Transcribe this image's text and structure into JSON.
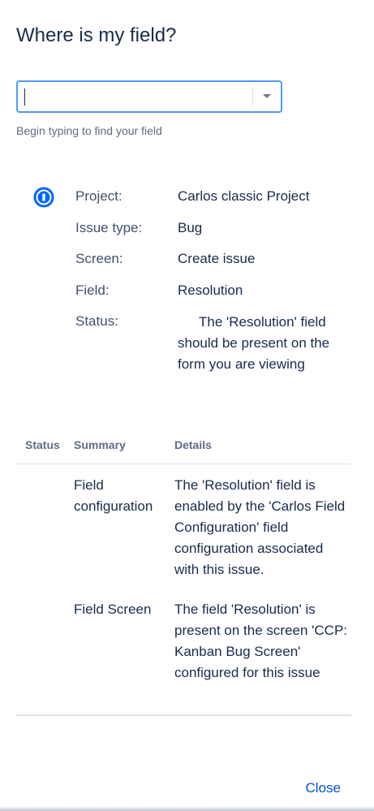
{
  "dialog": {
    "title": "Where is my field?",
    "close_label": "Close"
  },
  "search": {
    "value": "",
    "hint": "Begin typing to find your field"
  },
  "info": {
    "icon": "info-icon",
    "rows": [
      {
        "label": "Project:",
        "value": "Carlos classic Project"
      },
      {
        "label": "Issue type:",
        "value": "Bug"
      },
      {
        "label": "Screen:",
        "value": "Create issue"
      },
      {
        "label": "Field:",
        "value": "Resolution"
      },
      {
        "label": "Status:",
        "value": "The 'Resolution' field should be present on the form you are viewing"
      }
    ]
  },
  "table": {
    "headers": {
      "status": "Status",
      "summary": "Summary",
      "details": "Details"
    },
    "rows": [
      {
        "status": "",
        "summary": "Field configuration",
        "details": "The 'Resolution' field is enabled by the 'Carlos Field Configuration' field configuration associated with this issue."
      },
      {
        "status": "",
        "summary": "Field Screen",
        "details": "The field 'Resolution' is present on the screen 'CCP: Kanban Bug Screen' configured for this issue"
      }
    ]
  },
  "colors": {
    "accent": "#0052cc",
    "focus_border": "#4c9aff",
    "info_icon": "#0065ff"
  }
}
